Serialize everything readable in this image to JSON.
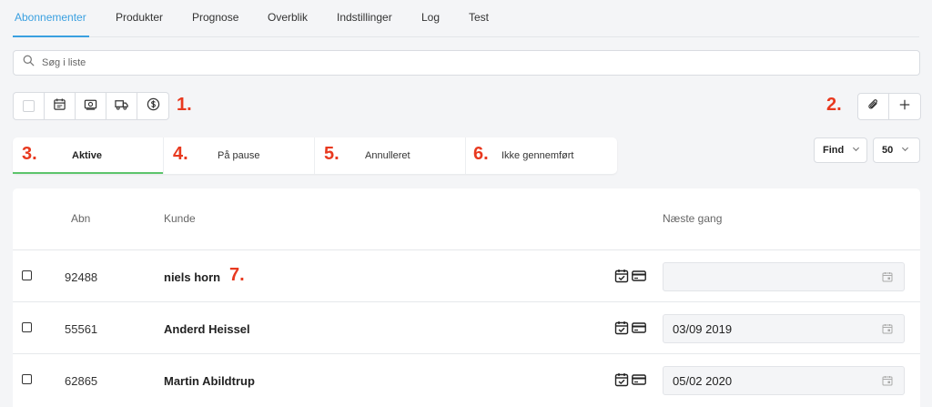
{
  "nav": {
    "tabs": [
      {
        "label": "Abonnementer",
        "active": true
      },
      {
        "label": "Produkter"
      },
      {
        "label": "Prognose"
      },
      {
        "label": "Overblik"
      },
      {
        "label": "Indstillinger"
      },
      {
        "label": "Log"
      },
      {
        "label": "Test"
      }
    ]
  },
  "search": {
    "placeholder": "Søg i liste",
    "value": ""
  },
  "annotations": [
    "1.",
    "2.",
    "3.",
    "4.",
    "5.",
    "6.",
    "7."
  ],
  "status_tabs": [
    {
      "label": "Aktive",
      "active": true
    },
    {
      "label": "På pause"
    },
    {
      "label": "Annulleret"
    },
    {
      "label": "Ikke gennemført"
    }
  ],
  "filters": {
    "find_label": "Find",
    "page_size": "50"
  },
  "table": {
    "headers": {
      "abn": "Abn",
      "kunde": "Kunde",
      "naeste_gang": "Næste gang"
    },
    "rows": [
      {
        "abn": "92488",
        "kunde": "niels horn",
        "naeste_gang": ""
      },
      {
        "abn": "55561",
        "kunde": "Anderd Heissel",
        "naeste_gang": "03/09 2019"
      },
      {
        "abn": "62865",
        "kunde": "Martin Abildtrup",
        "naeste_gang": "05/02 2020"
      }
    ]
  },
  "colors": {
    "accent": "#3aa0e0",
    "active_tab": "#5cc46b",
    "annotation": "#e8391f"
  },
  "icons": [
    "search-icon",
    "calendar-icon",
    "money-icon",
    "truck-icon",
    "dollar-icon",
    "paperclip-icon",
    "plus-icon",
    "chevron-down-icon",
    "calendar-check-icon",
    "credit-card-icon"
  ]
}
